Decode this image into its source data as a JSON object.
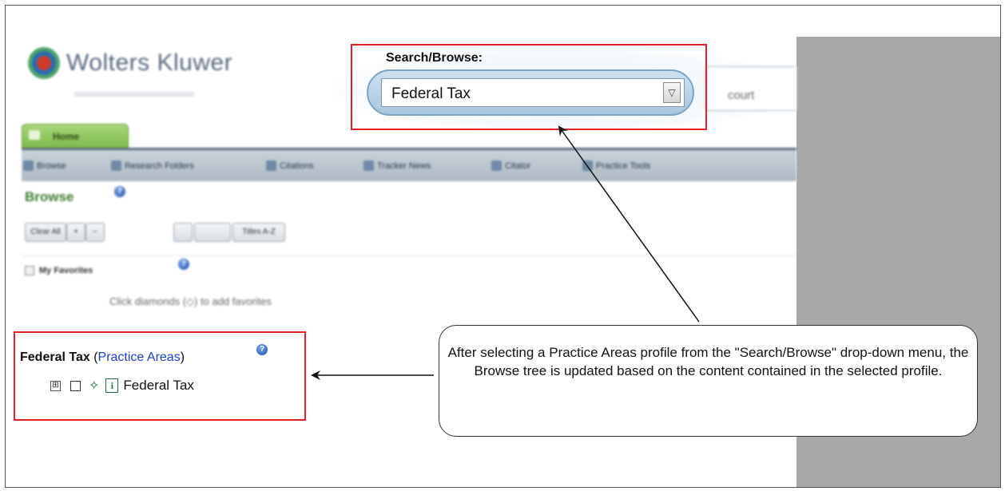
{
  "app": {
    "brand": "Wolters Kluwer",
    "home_tab": "Home",
    "toolbar": [
      {
        "label": "Browse",
        "icon": "browse-icon"
      },
      {
        "label": "Research Folders",
        "icon": "folder-icon"
      },
      {
        "label": "Citations",
        "icon": "citations-icon"
      },
      {
        "label": "Tracker News",
        "icon": "news-icon"
      },
      {
        "label": "Citator",
        "icon": "citator-icon"
      },
      {
        "label": "Practice Tools",
        "icon": "tools-icon"
      }
    ],
    "browse_title": "Browse",
    "buttons": {
      "clear_all": "Clear All",
      "titles": "Titles A-Z"
    },
    "favorites_label": "My Favorites",
    "favorites_hint": "Click diamonds (◇) to add favorites",
    "search_keyword_value": "court"
  },
  "search": {
    "label": "Search/Browse:",
    "selected": "Federal Tax",
    "dropdown_glyph": "▽"
  },
  "tree": {
    "heading_bold": "Federal Tax",
    "heading_open": " (",
    "heading_link": "Practice Areas",
    "heading_close": ")",
    "node_label": "Federal Tax",
    "expander": "⊞",
    "diamond": "✧",
    "info": "i"
  },
  "callout": {
    "text": "After selecting a Practice Areas profile from the \"Search/Browse\" drop-down menu, the Browse tree is updated based on the content contained in the selected profile."
  },
  "colors": {
    "highlight": "#e41f26",
    "link": "#1a3dcc",
    "brand_green": "#3c7a2e"
  }
}
